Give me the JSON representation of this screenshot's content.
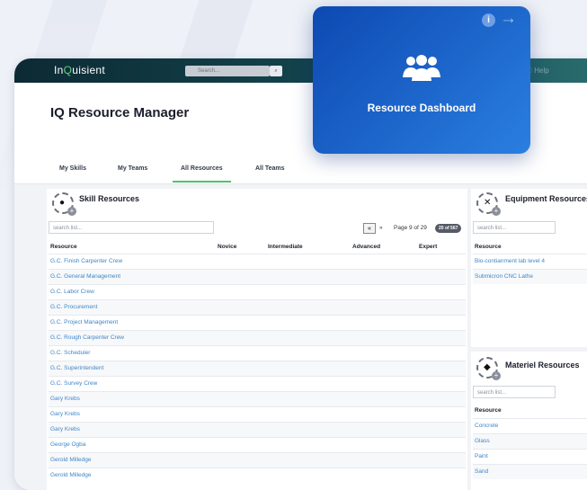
{
  "app": {
    "logo_pre": "In",
    "logo_q": "Q",
    "logo_post": "uisient",
    "search_placeholder": "Search...",
    "help_label": "Help",
    "page_title": "IQ Resource Manager"
  },
  "tabs": [
    {
      "label": "My Skills"
    },
    {
      "label": "My Teams"
    },
    {
      "label": "All Resources"
    },
    {
      "label": "All Teams"
    }
  ],
  "skill": {
    "title": "Skill Resources",
    "search_placeholder": "search list...",
    "page_text": "Page 9 of 29",
    "count_badge": "20 of 567",
    "columns": [
      "Resource",
      "Novice",
      "Intermediate",
      "Advanced",
      "Expert"
    ],
    "rows": [
      "G.C. Finish Carpenter Crew",
      "G.C. General Management",
      "G.C. Labor Crew",
      "G.C. Procurement",
      "G.C. Project Management",
      "G.C. Rough Carpenter Crew",
      "G.C. Scheduler",
      "G.C. Superintendent",
      "G.C. Survey Crew",
      "Gary Krebs",
      "Gary Krebs",
      "Gary Krebs",
      "George Ogba",
      "Gerold Milledge",
      "Gerold Milledge"
    ]
  },
  "equipment": {
    "title": "Equipment Resources",
    "search_placeholder": "search list...",
    "column": "Resource",
    "rows": [
      "Bio-contianment lab level 4",
      "Submicron CNC Lathe"
    ]
  },
  "materiel": {
    "title": "Materiel Resources",
    "search_placeholder": "search list...",
    "column": "Resource",
    "rows": [
      "Concrete",
      "Glass",
      "Paint",
      "Sand"
    ]
  },
  "overlay": {
    "title": "Resource Dashboard"
  },
  "colors": {
    "accent": "#4cc26e",
    "link": "#3f86c7",
    "overlay": "#1a5fcb"
  }
}
